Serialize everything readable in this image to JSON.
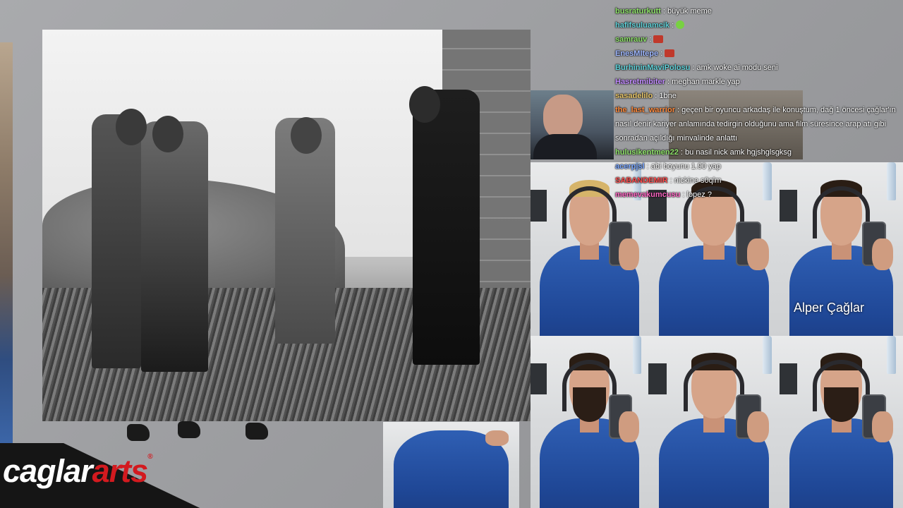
{
  "brand": {
    "part1": "cagl",
    "part2": "ar",
    "part3": "arts",
    "registered": "®"
  },
  "chat": [
    {
      "user": "busraturkutt",
      "color": "#8fe36a",
      "sep": " : ",
      "text": "büyük meme",
      "emote": null
    },
    {
      "user": "hafifsuluamcik",
      "color": "#5fd1d8",
      "sep": " : ",
      "text": "",
      "emote": "green-face-emote"
    },
    {
      "user": "samrauv",
      "color": "#8fe36a",
      "sep": " : ",
      "text": "",
      "emote": "red-face-emote"
    },
    {
      "user": "EnesMItepe",
      "color": "#9fb8ff",
      "sep": " : ",
      "text": "",
      "emote": "red-face-emote"
    },
    {
      "user": "BurhininMaviPolosu",
      "color": "#5fd1d8",
      "sep": " : ",
      "text": "amk woke ai modu seni",
      "emote": null
    },
    {
      "user": "Hasretmibiter",
      "color": "#c28cff",
      "sep": " : ",
      "text": "meghan markle yap",
      "emote": null
    },
    {
      "user": "sasadelilo",
      "color": "#e8c66a",
      "sep": " : ",
      "text": "1bne",
      "emote": null
    },
    {
      "user": "the_last_warrior",
      "color": "#ff8a3d",
      "sep": " : ",
      "text": "geçen bir oyuncu arkadaş ile konuştum, dağ 1 öncesi çağlar'ın nasıl denir kariyer anlamında tedirgin olduğunu ama film süresince arap atı gibi sonradan açıldığı minvalinde anlattı",
      "emote": null
    },
    {
      "user": "hulusikentmen22",
      "color": "#8fe36a",
      "sep": " : ",
      "text": "bu nasil nick amk hgjshglsgksg",
      "emote": null
    },
    {
      "user": "acerpjsl",
      "color": "#7aa7ff",
      "sep": " : ",
      "text": "abi boyunu 1.90 yap",
      "emote": null
    },
    {
      "user": "SABANDEMIR",
      "color": "#ff4d4d",
      "sep": " : ",
      "text": "nickine s0qlm",
      "emote": null
    },
    {
      "user": "memevakumcusu",
      "color": "#ff66c4",
      "sep": " : ",
      "text": "lopez ?",
      "emote": null
    }
  ],
  "grid_caption": "Alper Çağlar",
  "colors": {
    "shirt": "#2a5bb0",
    "brand_red": "#d31a1f",
    "background": "#9d9ea1"
  }
}
